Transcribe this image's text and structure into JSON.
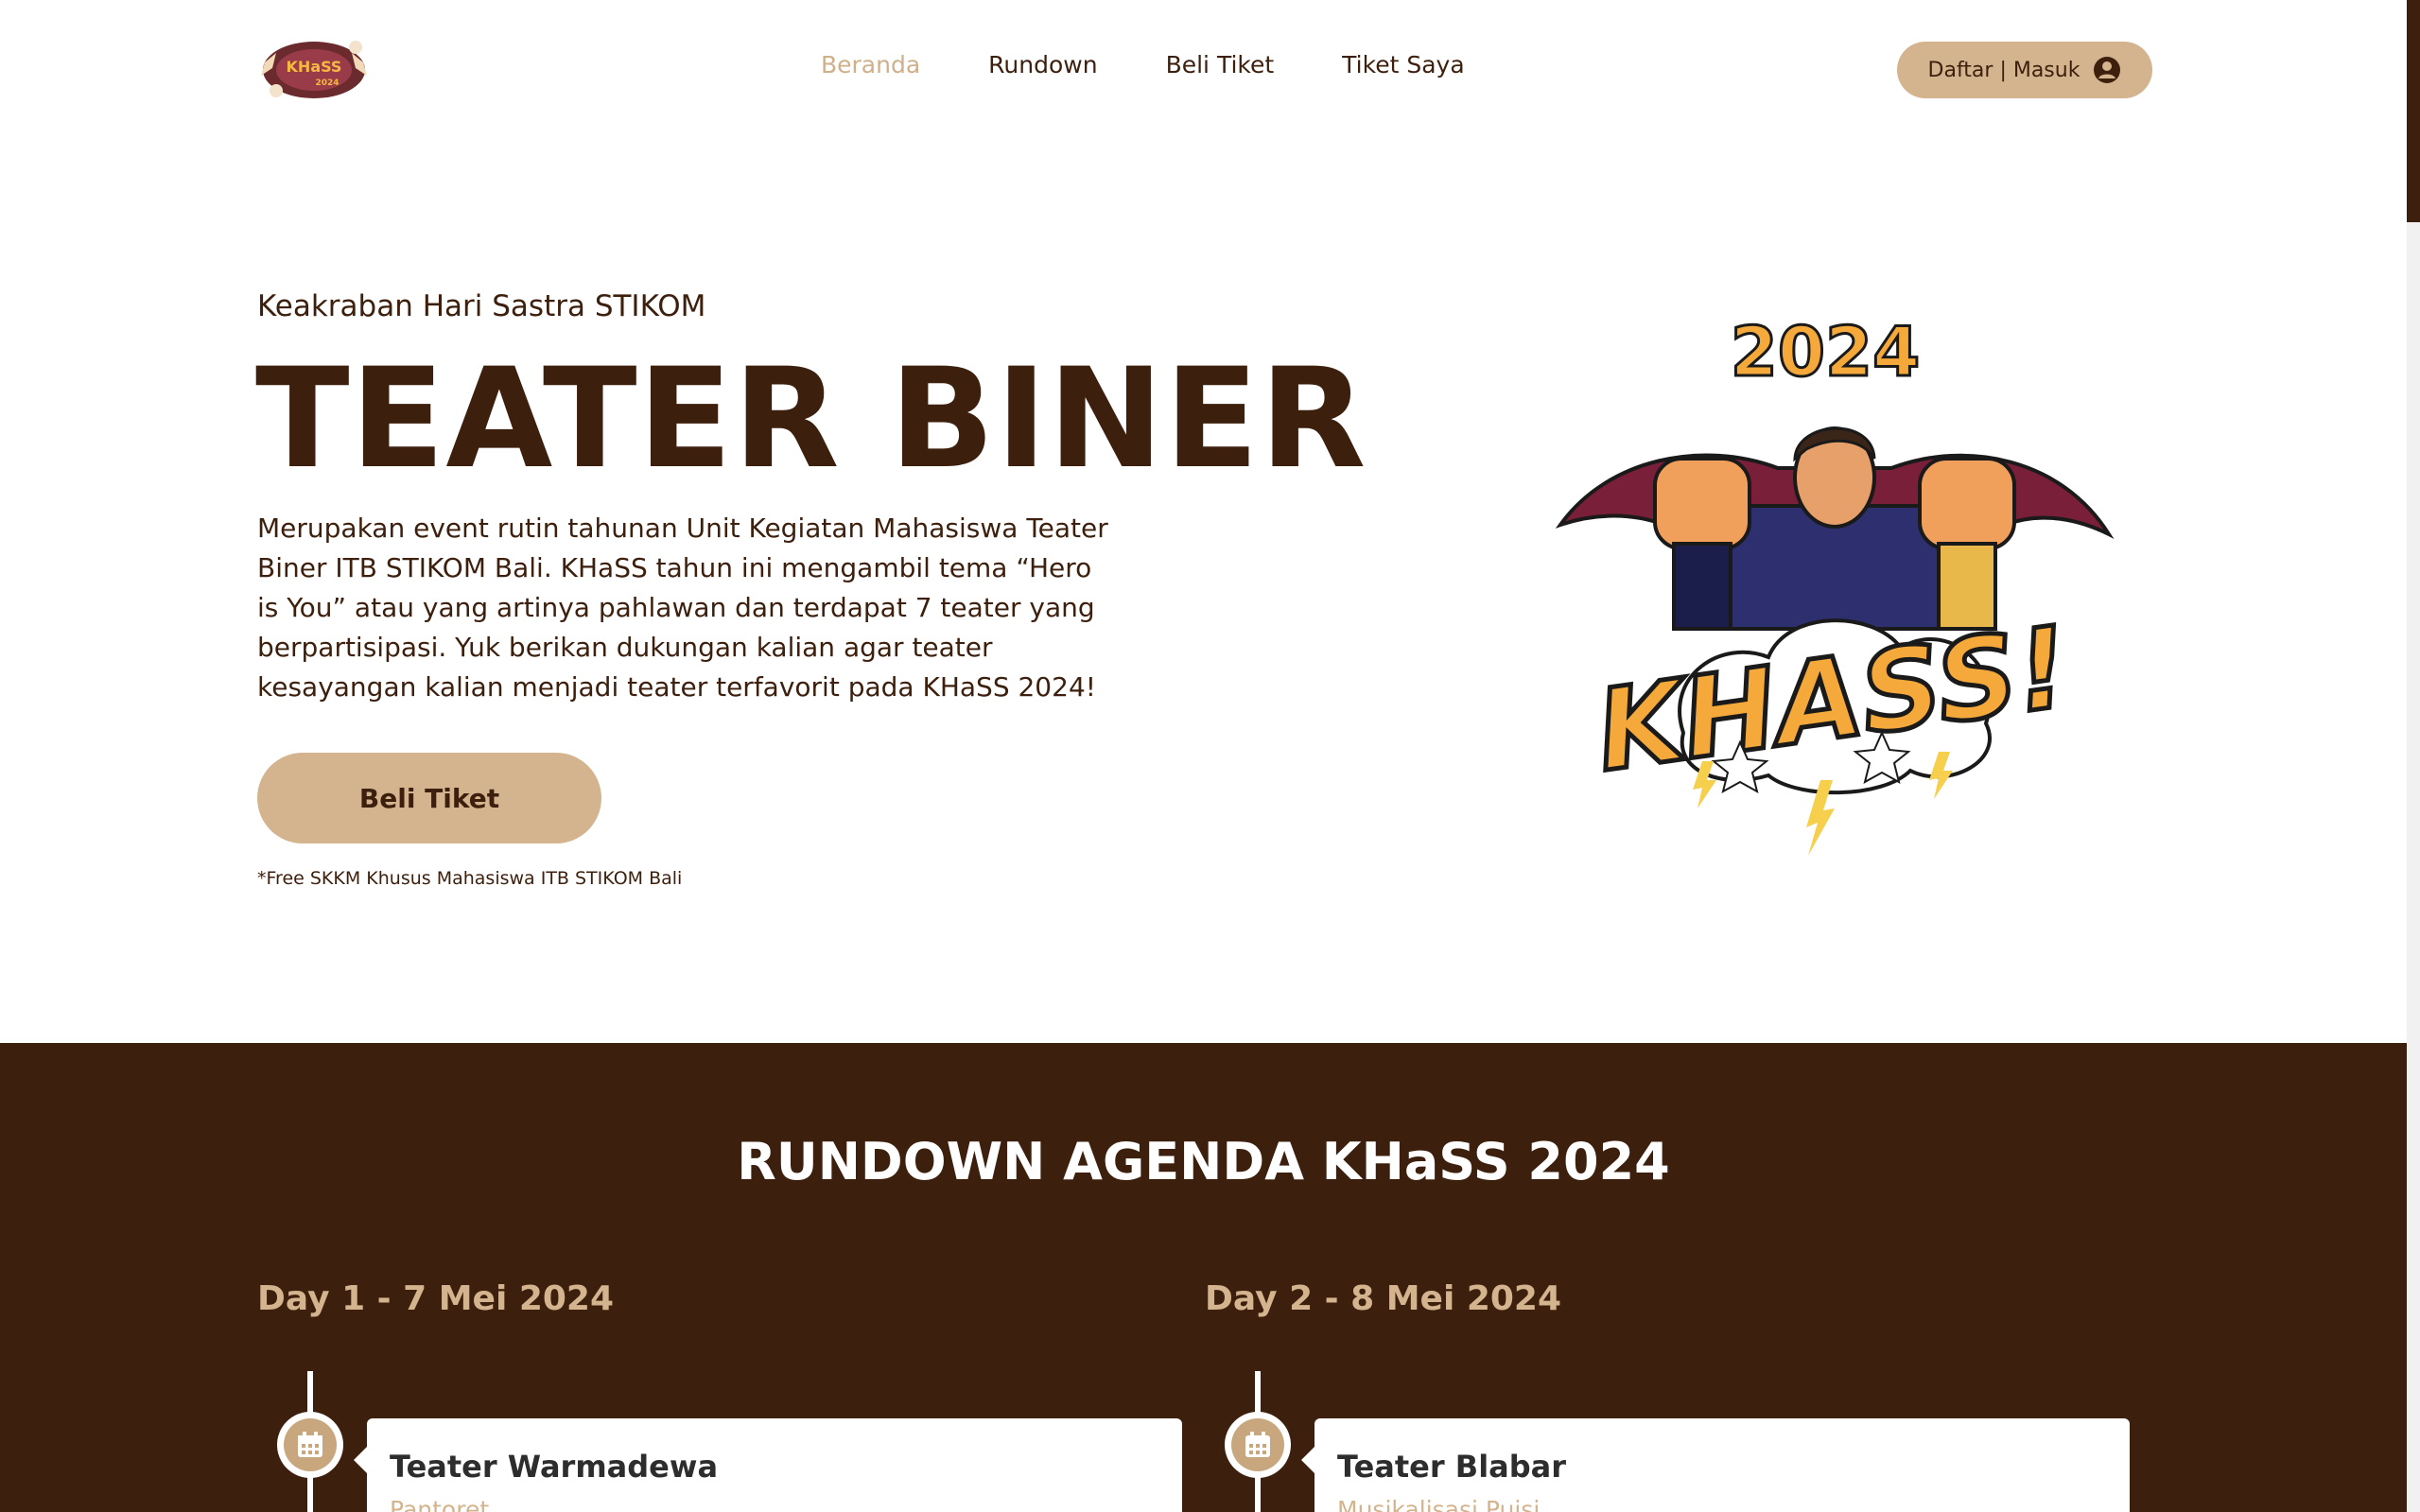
{
  "nav": {
    "logo_text": "KHaSS 2024",
    "items": [
      {
        "label": "Beranda",
        "active": true
      },
      {
        "label": "Rundown",
        "active": false
      },
      {
        "label": "Beli Tiket",
        "active": false
      },
      {
        "label": "Tiket Saya",
        "active": false
      }
    ],
    "auth_label": "Daftar | Masuk"
  },
  "hero": {
    "subtitle": "Keakraban Hari Sastra STIKOM",
    "title": "TEATER BINER",
    "description": "Merupakan event rutin tahunan Unit Kegiatan Mahasiswa Teater Biner ITB STIKOM Bali. KHaSS tahun ini mengambil tema “Hero is You” atau yang artinya pahlawan dan terdapat 7 teater yang berpartisipasi. Yuk berikan dukungan kalian agar teater kesayangan kalian menjadi teater terfavorit pada KHaSS 2024!",
    "cta_label": "Beli Tiket",
    "note": "*Free SKKM Khusus Mahasiswa ITB STIKOM Bali",
    "art_year": "2024",
    "art_word": "KHASS!"
  },
  "rundown": {
    "title": "RUNDOWN AGENDA KHaSS 2024",
    "days": [
      {
        "title": "Day 1 - 7 Mei 2024",
        "events": [
          {
            "name": "Teater Warmadewa",
            "subtitle": "Pantoret"
          }
        ]
      },
      {
        "title": "Day 2 - 8 Mei 2024",
        "events": [
          {
            "name": "Teater Blabar",
            "subtitle": "Musikalisasi Puisi"
          }
        ]
      }
    ]
  },
  "colors": {
    "brand_brown": "#3d1f0d",
    "accent_tan": "#d3b48e",
    "white": "#ffffff"
  },
  "icons": {
    "user": "user-circle-icon",
    "calendar": "calendar-icon"
  }
}
